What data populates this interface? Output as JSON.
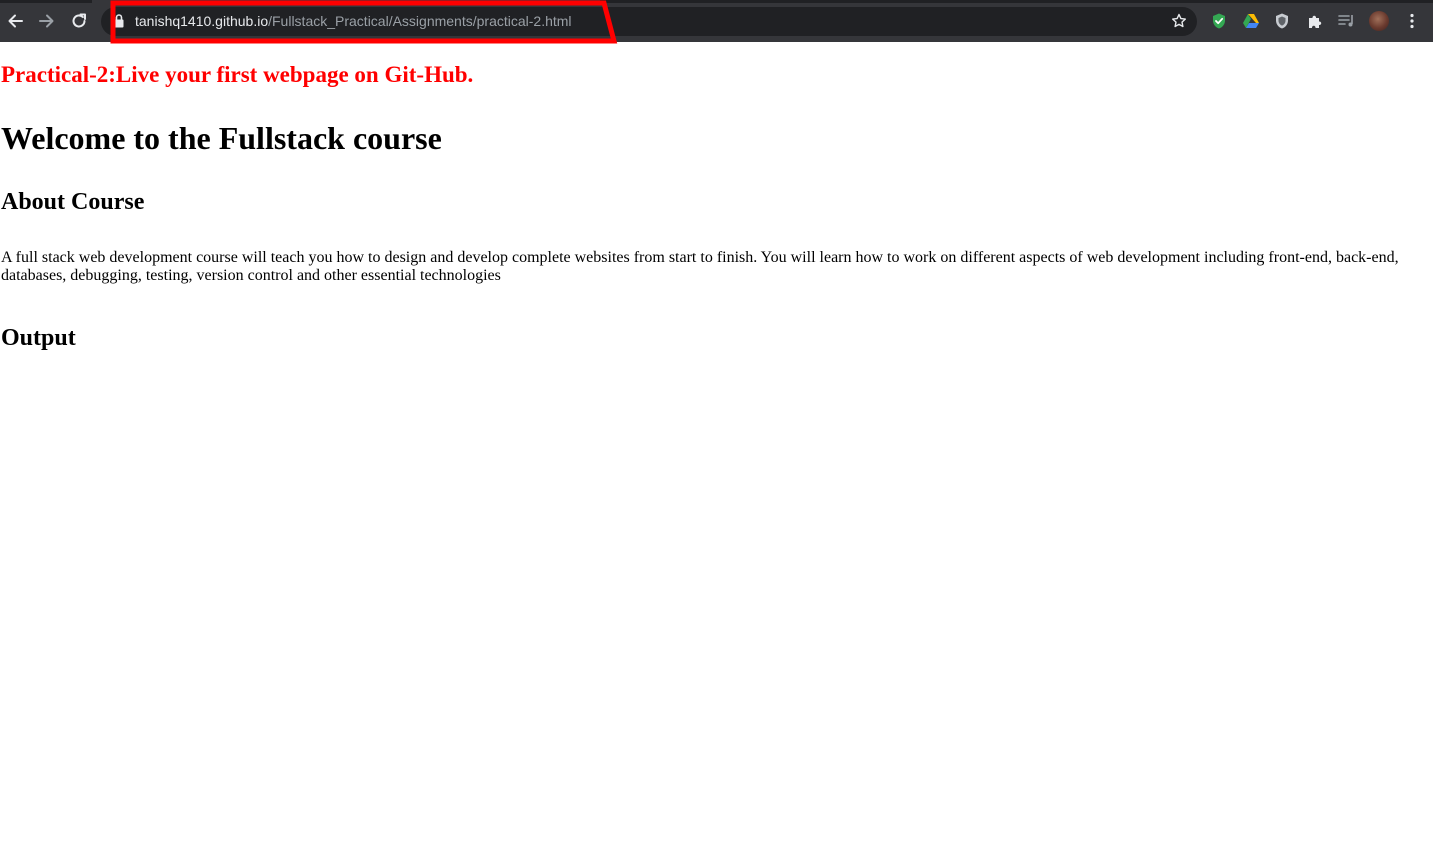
{
  "browser": {
    "url_host": "tanishq1410.github.io",
    "url_path": "/Fullstack_Practical/Assignments/practical-2.html",
    "icons": {
      "back": "back-arrow-icon",
      "forward": "forward-arrow-icon",
      "reload": "reload-icon",
      "lock": "lock-icon",
      "bookmark": "star-icon",
      "extensions": [
        "shield-check-icon",
        "google-drive-icon",
        "shield-icon",
        "puzzle-icon",
        "media-queue-icon"
      ],
      "profile": "avatar",
      "menu": "three-dot-menu-icon"
    },
    "colors": {
      "toolbar": "#35363a",
      "omnibox": "#202124",
      "highlight": "#ff0000"
    }
  },
  "page": {
    "subtitle": "Practical-2:Live your first webpage on Git-Hub.",
    "title": "Welcome to the Fullstack course",
    "about_heading": "About Course",
    "about_text": "A full stack web development course will teach you how to design and develop complete websites from start to finish. You will learn how to work on different aspects of web development including front-end, back-end, databases, debugging, testing, version control and other essential technologies",
    "output_heading": "Output",
    "colors": {
      "subtitle": "#ff0000",
      "text": "#000000"
    }
  }
}
